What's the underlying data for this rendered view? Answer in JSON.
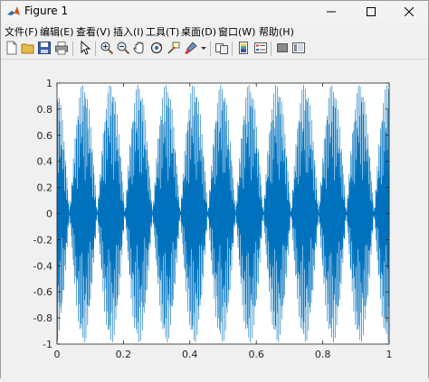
{
  "window": {
    "title": "Figure 1"
  },
  "menu": {
    "items": [
      "文件(F)",
      "编辑(E)",
      "查看(V)",
      "插入(I)",
      "工具(T)",
      "桌面(D)",
      "窗口(W)",
      "帮助(H)"
    ]
  },
  "toolbar": {
    "buttons": [
      "new-figure",
      "open-file",
      "save",
      "print",
      "edit-plot",
      "zoom-in",
      "zoom-out",
      "pan",
      "rotate-3d",
      "data-cursor",
      "brush",
      "link-plot",
      "colorbar",
      "legend",
      "hide-plot-tools",
      "show-plot-tools"
    ]
  },
  "colors": {
    "line": "#0072bd",
    "axes_bg": "#ffffff",
    "figure_bg": "#f0f0f0"
  },
  "chart_data": {
    "type": "line",
    "title": "",
    "xlabel": "",
    "ylabel": "",
    "xlim": [
      0,
      1
    ],
    "ylim": [
      -1,
      1
    ],
    "xticks": [
      "0",
      "0.2",
      "0.4",
      "0.6",
      "0.8",
      "1"
    ],
    "yticks": [
      "1",
      "0.8",
      "0.6",
      "0.4",
      "0.2",
      "0",
      "-0.2",
      "-0.4",
      "-0.6",
      "-0.8",
      "-1"
    ],
    "grid": false,
    "legend": "none",
    "series": [
      {
        "description_points": "dense oscillation filling [-1,1] with beat pattern",
        "x": [
          0,
          0.04,
          0.08,
          0.12,
          0.16,
          0.2,
          0.24,
          0.28,
          0.32,
          0.36,
          0.4,
          0.44,
          0.48,
          0.52,
          0.56,
          0.6,
          0.64,
          0.68,
          0.72,
          0.76,
          0.8,
          0.84,
          0.88,
          0.92,
          0.96,
          1
        ],
        "y_envelope": [
          1,
          0.92,
          0.85,
          0.9,
          0.88,
          0.86,
          0.8,
          0.75,
          0.72,
          0.7,
          0.75,
          0.8,
          0.78,
          0.72,
          0.7,
          0.75,
          0.8,
          0.82,
          0.85,
          0.86,
          0.88,
          0.9,
          0.92,
          0.9,
          0.95,
          1
        ]
      }
    ]
  }
}
